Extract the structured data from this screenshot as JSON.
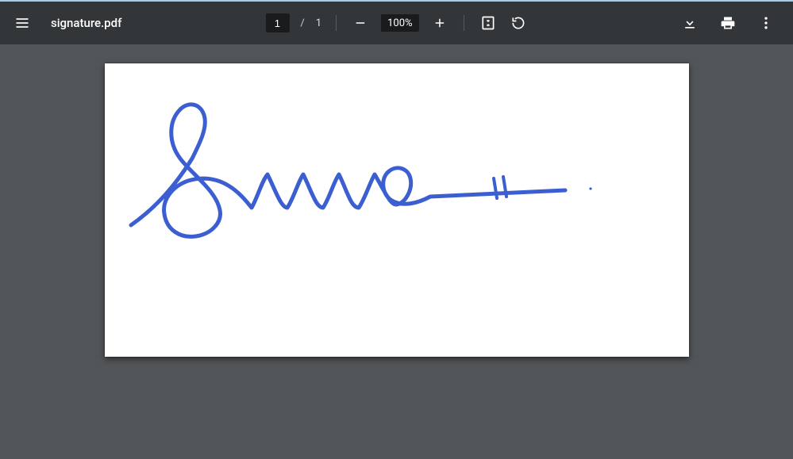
{
  "header": {
    "filename": "signature.pdf",
    "page_current": "1",
    "page_separator": "/",
    "page_total": "1",
    "zoom_level": "100%"
  },
  "icons": {
    "menu": "menu-icon",
    "zoom_out": "zoom-out-icon",
    "zoom_in": "zoom-in-icon",
    "fit": "fit-page-icon",
    "rotate": "rotate-icon",
    "download": "download-icon",
    "print": "print-icon",
    "more": "more-icon"
  },
  "document": {
    "signature_color": "#3b5fd1"
  }
}
